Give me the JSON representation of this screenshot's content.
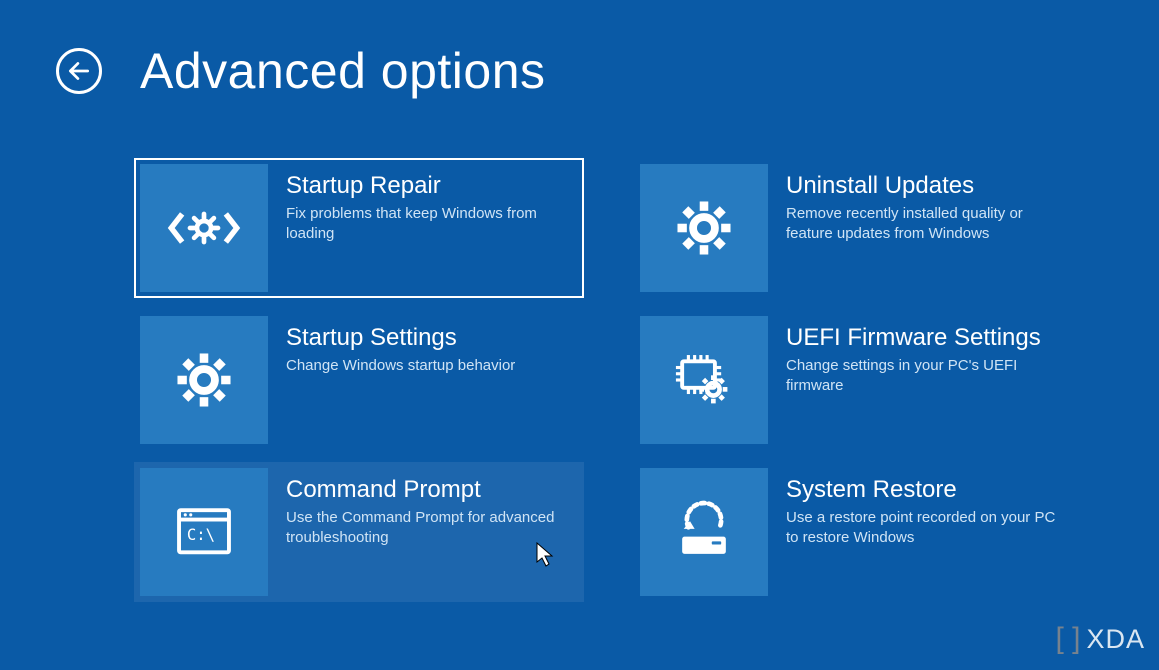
{
  "header": {
    "title": "Advanced options"
  },
  "options": [
    {
      "title": "Startup Repair",
      "description": "Fix problems that keep Windows from loading",
      "icon": "repair-icon",
      "selected": true
    },
    {
      "title": "Uninstall Updates",
      "description": "Remove recently installed quality or feature updates from Windows",
      "icon": "gear-icon"
    },
    {
      "title": "Startup Settings",
      "description": "Change Windows startup behavior",
      "icon": "gear-icon"
    },
    {
      "title": "UEFI Firmware Settings",
      "description": "Change settings in your PC's UEFI firmware",
      "icon": "firmware-icon"
    },
    {
      "title": "Command Prompt",
      "description": "Use the Command Prompt for advanced troubleshooting",
      "icon": "terminal-icon",
      "hovered": true
    },
    {
      "title": "System Restore",
      "description": "Use a restore point recorded on your PC to restore Windows",
      "icon": "restore-icon"
    }
  ],
  "watermark": {
    "text": "XDA"
  }
}
